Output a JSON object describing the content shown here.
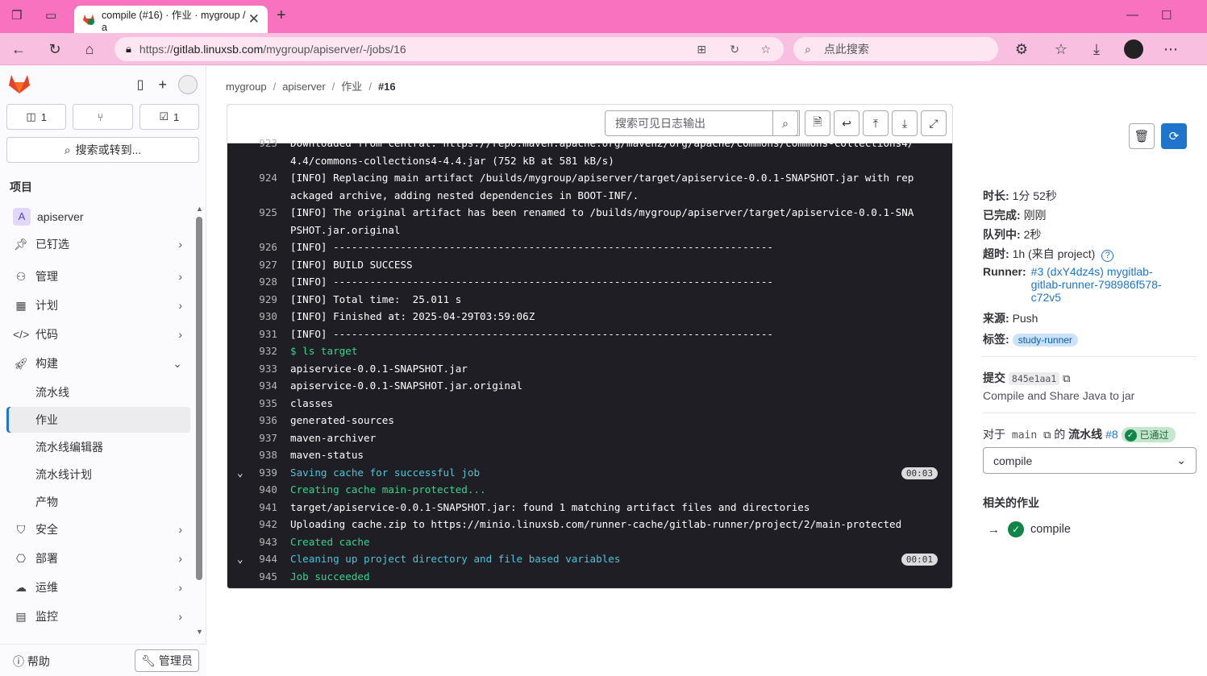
{
  "browser": {
    "tab_title": "compile (#16) · 作业 · mygroup / a",
    "url_prefix": "https://",
    "url_host": "gitlab.linuxsb.com",
    "url_path": "/mygroup/apiserver/-/jobs/16",
    "search_placeholder": "点此搜索"
  },
  "sidebar": {
    "counts": {
      "issues": "1",
      "merge_requests": "",
      "todos": "1"
    },
    "search_label": "搜索或转到...",
    "section_title": "项目",
    "project_avatar": "A",
    "project_name": "apiserver",
    "items": [
      {
        "label": "已钉选"
      },
      {
        "label": "管理"
      },
      {
        "label": "计划"
      },
      {
        "label": "代码"
      },
      {
        "label": "构建"
      },
      {
        "label": "流水线"
      },
      {
        "label": "作业"
      },
      {
        "label": "流水线编辑器"
      },
      {
        "label": "流水线计划"
      },
      {
        "label": "产物"
      },
      {
        "label": "安全"
      },
      {
        "label": "部署"
      },
      {
        "label": "运维"
      },
      {
        "label": "监控"
      }
    ],
    "help_label": "帮助",
    "admin_label": "管理员"
  },
  "breadcrumb": [
    "mygroup",
    "apiserver",
    "作业",
    "#16"
  ],
  "log": {
    "search_placeholder": "搜索可见日志输出",
    "lines": [
      {
        "n": "923",
        "t": "Downloaded from central: https://repo.maven.apache.org/maven2/org/apache/commons/commons-collections4/"
      },
      {
        "n": "",
        "t": "4.4/commons-collections4-4.4.jar (752 kB at 581 kB/s)"
      },
      {
        "n": "924",
        "t": "[INFO] Replacing main artifact /builds/mygroup/apiserver/target/apiservice-0.0.1-SNAPSHOT.jar with rep"
      },
      {
        "n": "",
        "t": "ackaged archive, adding nested dependencies in BOOT-INF/."
      },
      {
        "n": "925",
        "t": "[INFO] The original artifact has been renamed to /builds/mygroup/apiserver/target/apiservice-0.0.1-SNA"
      },
      {
        "n": "",
        "t": "PSHOT.jar.original"
      },
      {
        "n": "926",
        "t": "[INFO] ------------------------------------------------------------------------"
      },
      {
        "n": "927",
        "t": "[INFO] BUILD SUCCESS"
      },
      {
        "n": "928",
        "t": "[INFO] ------------------------------------------------------------------------"
      },
      {
        "n": "929",
        "t": "[INFO] Total time:  25.011 s"
      },
      {
        "n": "930",
        "t": "[INFO] Finished at: 2025-04-29T03:59:06Z"
      },
      {
        "n": "931",
        "t": "[INFO] ------------------------------------------------------------------------"
      },
      {
        "n": "932",
        "t": "$ ls target"
      },
      {
        "n": "933",
        "t": "apiservice-0.0.1-SNAPSHOT.jar"
      },
      {
        "n": "934",
        "t": "apiservice-0.0.1-SNAPSHOT.jar.original"
      },
      {
        "n": "935",
        "t": "classes"
      },
      {
        "n": "936",
        "t": "generated-sources"
      },
      {
        "n": "937",
        "t": "maven-archiver"
      },
      {
        "n": "938",
        "t": "maven-status"
      },
      {
        "n": "939",
        "t": "Saving cache for successful job",
        "dur": "00:03"
      },
      {
        "n": "940",
        "t": "Creating cache main-protected..."
      },
      {
        "n": "941",
        "t": "target/apiservice-0.0.1-SNAPSHOT.jar: found 1 matching artifact files and directories"
      },
      {
        "n": "942",
        "t": "Uploading cache.zip to https://minio.linuxsb.com/runner-cache/gitlab-runner/project/2/main-protected"
      },
      {
        "n": "943",
        "t": "Created cache"
      },
      {
        "n": "944",
        "t": "Cleaning up project directory and file based variables",
        "dur": "00:01"
      },
      {
        "n": "945",
        "t": "Job succeeded"
      }
    ]
  },
  "job": {
    "duration_label": "时长:",
    "duration": "1分 52秒",
    "finished_label": "已完成:",
    "finished": "刚刚",
    "queued_label": "队列中:",
    "queued": "2秒",
    "timeout_label": "超时:",
    "timeout": "1h (来自 project)",
    "runner_label": "Runner:",
    "runner_line1": "#3 (dxY4dz4s) mygitlab-",
    "runner_line2": "gitlab-runner-798986f578-",
    "runner_line3": "c72v5",
    "source_label": "来源:",
    "source": "Push",
    "tags_label": "标签:",
    "tag": "study-runner",
    "commit_label": "提交",
    "commit_sha": "845e1aa1",
    "commit_message": "Compile and Share Java to jar",
    "for_label": "对于",
    "branch": "main",
    "of_label": "的",
    "pipeline_label": "流水线",
    "pipeline_id": "#8",
    "pipeline_status": "已通过",
    "stage_select": "compile",
    "related_title": "相关的作业",
    "related_job": "compile"
  }
}
